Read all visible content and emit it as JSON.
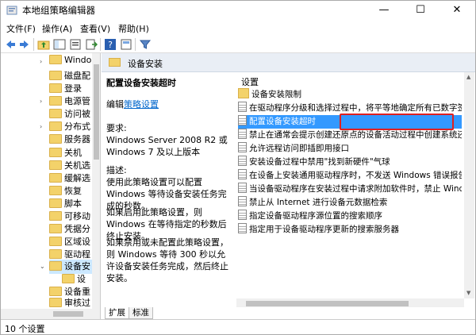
{
  "window": {
    "title": "本地组策略编辑器",
    "controls": {
      "minimize": "—",
      "maximize": "☐",
      "close": "✕"
    }
  },
  "menu": [
    "文件(F)",
    "操作(A)",
    "查看(V)",
    "帮助(H)"
  ],
  "toolbar": {
    "icons": [
      "back-icon",
      "forward-icon",
      "up-folder-icon",
      "show-tree-icon",
      "properties-icon",
      "export-icon",
      "help-icon",
      "view-icon",
      "filter-icon"
    ]
  },
  "tree": {
    "items": [
      {
        "label": "Windo",
        "expandable": true
      },
      {
        "label": "磁盘配",
        "expandable": false
      },
      {
        "label": "登录",
        "expandable": false
      },
      {
        "label": "电源管",
        "expandable": true
      },
      {
        "label": "访问被",
        "expandable": false
      },
      {
        "label": "分布式",
        "expandable": true
      },
      {
        "label": "服务器",
        "expandable": false
      },
      {
        "label": "关机",
        "expandable": false
      },
      {
        "label": "关机选",
        "expandable": false
      },
      {
        "label": "缓解选",
        "expandable": false
      },
      {
        "label": "恢复",
        "expandable": false
      },
      {
        "label": "脚本",
        "expandable": false
      },
      {
        "label": "可移动",
        "expandable": false
      },
      {
        "label": "凭据分",
        "expandable": false
      },
      {
        "label": "区域设",
        "expandable": false
      },
      {
        "label": "驱动程",
        "expandable": false
      },
      {
        "label": "设备安",
        "expandable": true,
        "expanded": true,
        "selected": true
      },
      {
        "label": "设",
        "child": true
      },
      {
        "label": "设备重",
        "expandable": false
      },
      {
        "label": "审核过",
        "expandable": false
      }
    ]
  },
  "content": {
    "header": "设备安装",
    "description": {
      "title": "配置设备安装超时",
      "edit_prefix": "编辑",
      "edit_link": "策略设置",
      "requirements_label": "要求:",
      "requirements": "Windows Server 2008 R2 或 Windows 7 及以上版本",
      "desc_label": "描述:",
      "desc_1": "使用此策略设置可以配置 Windows 等待设备安装任务完成的秒数。",
      "desc_2": "如果启用此策略设置，则 Windows 在等待指定的秒数后终止安装。",
      "desc_3": "如果禁用或未配置此策略设置，则 Windows 等待 300 秒以允许设备安装任务完成，然后终止安装。"
    },
    "list_header": "设置",
    "settings": [
      {
        "label": "设备安装限制",
        "type": "folder"
      },
      {
        "label": "在驱动程序分级和选择过程中，将平等地确定所有已数字签...",
        "type": "policy"
      },
      {
        "label": "配置设备安装超时",
        "type": "policy",
        "selected": true
      },
      {
        "label": "禁止在通常会提示创建还原点的设备活动过程中创建系统还...",
        "type": "policy"
      },
      {
        "label": "允许远程访问即插即用接口",
        "type": "policy"
      },
      {
        "label": "安装设备过程中禁用\"找到新硬件\"气球",
        "type": "policy"
      },
      {
        "label": "在设备上安装通用驱动程序时，不发送 Windows 错误报告",
        "type": "policy"
      },
      {
        "label": "当设备驱动程序在安装过程中请求附加软件时，禁止 Wind...",
        "type": "policy"
      },
      {
        "label": "禁止从 Internet 进行设备元数据检索",
        "type": "policy"
      },
      {
        "label": "指定设备驱动程序源位置的搜索顺序",
        "type": "policy"
      },
      {
        "label": "指定用于设备驱动程序更新的搜索服务器",
        "type": "policy"
      }
    ],
    "tabs": [
      "扩展",
      "标准"
    ]
  },
  "status": "10 个设置"
}
